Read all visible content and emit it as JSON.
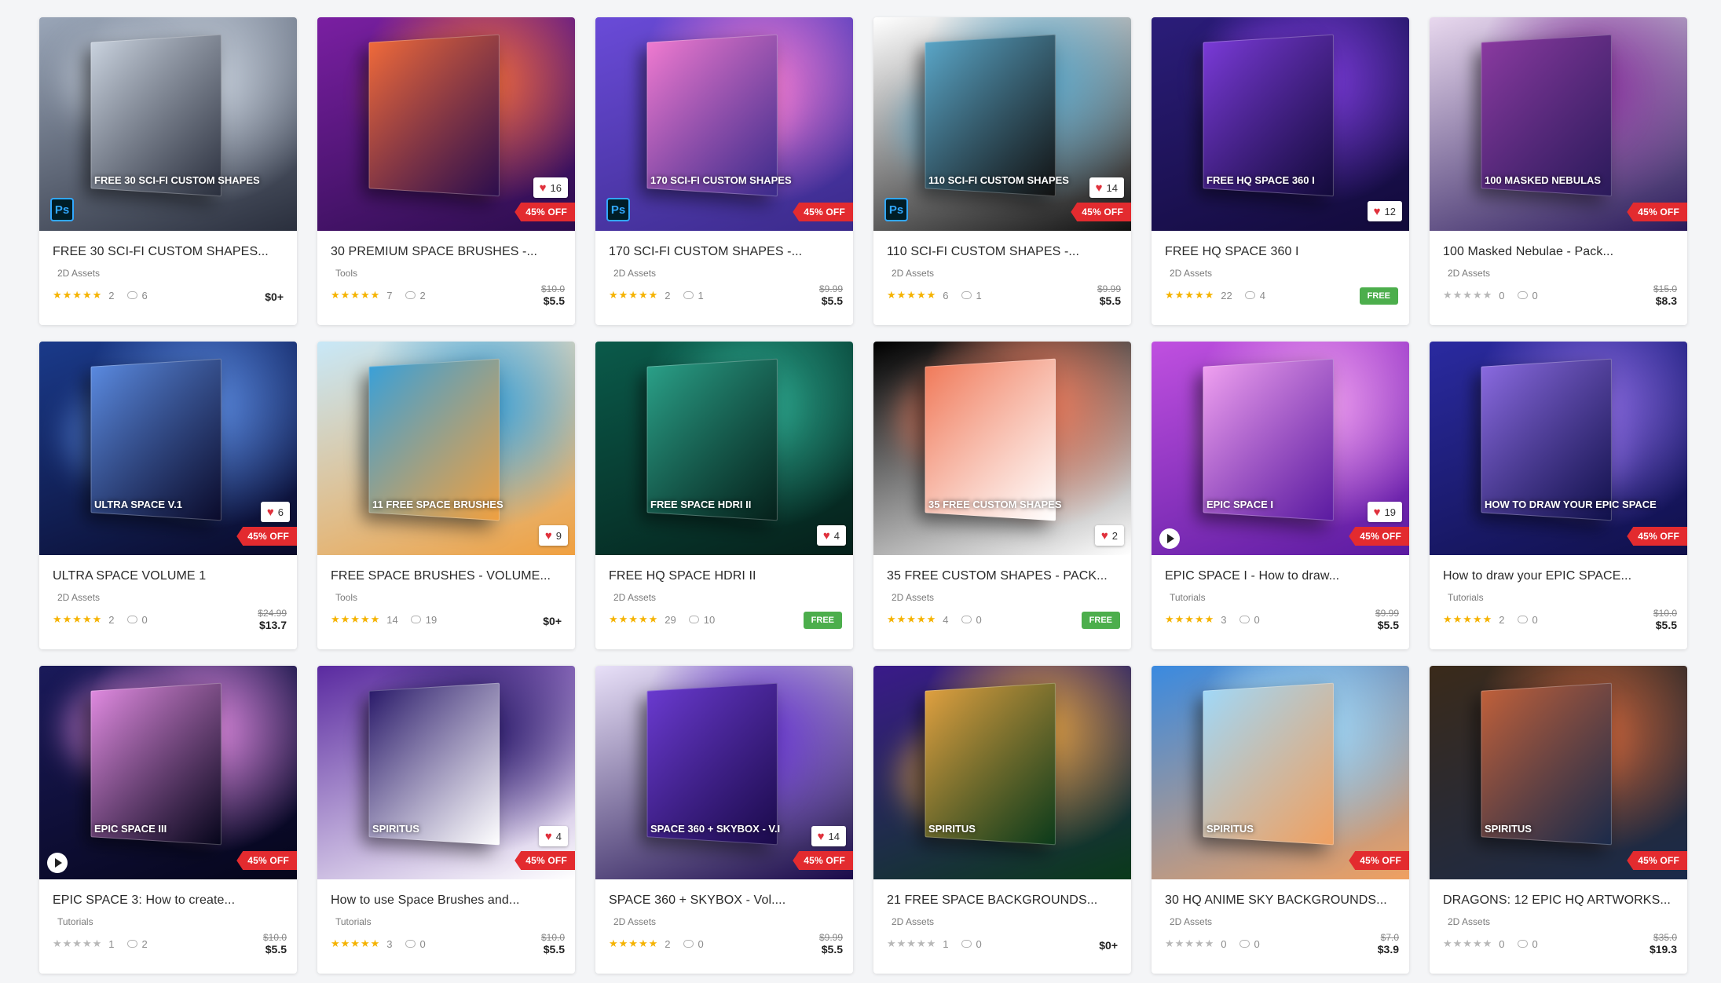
{
  "cards": [
    {
      "title": "FREE 30 SCI-FI CUSTOM SHAPES...",
      "category": "2D Assets",
      "rating": 5,
      "rating_count": "2",
      "comments": "6",
      "price_old": "",
      "price": "$0+",
      "price_type": "plus",
      "likes": "",
      "off": "",
      "ps": true,
      "play": false,
      "art_text": "FREE 30 SCI-FI CUSTOM SHAPES",
      "bg": [
        "#9aa6b8",
        "#c9d2de",
        "#2a2f3d"
      ]
    },
    {
      "title": "30 PREMIUM SPACE BRUSHES -...",
      "category": "Tools",
      "rating": 5,
      "rating_count": "7",
      "comments": "2",
      "price_old": "$10.0",
      "price": "$5.5",
      "price_type": "sale",
      "likes": "16",
      "off": "45% OFF",
      "ps": false,
      "play": false,
      "art_text": "",
      "bg": [
        "#7a1fa2",
        "#f06a3a",
        "#2b0d4d"
      ]
    },
    {
      "title": "170 SCI-FI CUSTOM SHAPES -...",
      "category": "2D Assets",
      "rating": 5,
      "rating_count": "2",
      "comments": "1",
      "price_old": "$9.99",
      "price": "$5.5",
      "price_type": "sale",
      "likes": "",
      "off": "45% OFF",
      "ps": true,
      "play": false,
      "art_text": "170 SCI-FI CUSTOM SHAPES",
      "bg": [
        "#6a4bd8",
        "#f07ad0",
        "#3a2a8a"
      ]
    },
    {
      "title": "110 SCI-FI CUSTOM SHAPES -...",
      "category": "2D Assets",
      "rating": 5,
      "rating_count": "6",
      "comments": "1",
      "price_old": "$9.99",
      "price": "$5.5",
      "price_type": "sale",
      "likes": "14",
      "off": "45% OFF",
      "ps": true,
      "play": false,
      "art_text": "110 SCI-FI CUSTOM SHAPES",
      "bg": [
        "#ffffff",
        "#5aa6c8",
        "#111111"
      ]
    },
    {
      "title": "FREE HQ SPACE 360 I",
      "category": "2D Assets",
      "rating": 5,
      "rating_count": "22",
      "comments": "4",
      "price_old": "",
      "price": "FREE",
      "price_type": "free",
      "likes": "12",
      "off": "",
      "ps": false,
      "play": false,
      "art_text": "FREE HQ SPACE 360 I",
      "bg": [
        "#2b1d7a",
        "#7a3ad8",
        "#120a3a"
      ]
    },
    {
      "title": "100 Masked Nebulae - Pack...",
      "category": "2D Assets",
      "rating": 0,
      "rating_count": "0",
      "comments": "0",
      "price_old": "$15.0",
      "price": "$8.3",
      "price_type": "sale",
      "likes": "",
      "off": "45% OFF",
      "ps": false,
      "play": false,
      "art_text": "100 MASKED NEBULAS",
      "bg": [
        "#e8d8ee",
        "#8a3aa0",
        "#2a1a5a"
      ]
    },
    {
      "title": "ULTRA SPACE VOLUME 1",
      "category": "2D Assets",
      "rating": 5,
      "rating_count": "2",
      "comments": "0",
      "price_old": "$24.99",
      "price": "$13.7",
      "price_type": "sale",
      "likes": "6",
      "off": "45% OFF",
      "ps": false,
      "play": false,
      "art_text": "ULTRA SPACE V.1",
      "bg": [
        "#1a3a8a",
        "#5a8ae0",
        "#0a0a2a"
      ]
    },
    {
      "title": "FREE SPACE BRUSHES - VOLUME...",
      "category": "Tools",
      "rating": 5,
      "rating_count": "14",
      "comments": "19",
      "price_old": "",
      "price": "$0+",
      "price_type": "plus",
      "likes": "9",
      "off": "",
      "ps": false,
      "play": false,
      "art_text": "11 FREE SPACE BRUSHES",
      "bg": [
        "#c8e8f8",
        "#3aa0d8",
        "#f0a040"
      ]
    },
    {
      "title": "FREE HQ SPACE HDRI II",
      "category": "2D Assets",
      "rating": 5,
      "rating_count": "29",
      "comments": "10",
      "price_old": "",
      "price": "FREE",
      "price_type": "free",
      "likes": "4",
      "off": "",
      "ps": false,
      "play": false,
      "art_text": "FREE SPACE HDRI II",
      "bg": [
        "#0a5a4a",
        "#2aa088",
        "#05201a"
      ]
    },
    {
      "title": "35 FREE CUSTOM SHAPES - PACK...",
      "category": "2D Assets",
      "rating": 5,
      "rating_count": "4",
      "comments": "0",
      "price_old": "",
      "price": "FREE",
      "price_type": "free",
      "likes": "2",
      "off": "",
      "ps": false,
      "play": false,
      "art_text": "35 FREE CUSTOM SHAPES",
      "bg": [
        "#000000",
        "#f07a5a",
        "#ffffff"
      ]
    },
    {
      "title": "EPIC SPACE I - How to draw...",
      "category": "Tutorials",
      "rating": 5,
      "rating_count": "3",
      "comments": "0",
      "price_old": "$9.99",
      "price": "$5.5",
      "price_type": "sale",
      "likes": "19",
      "off": "45% OFF",
      "ps": false,
      "play": true,
      "art_text": "EPIC SPACE I",
      "bg": [
        "#c050e0",
        "#f0a0f0",
        "#5a1aa0"
      ]
    },
    {
      "title": "How to draw your EPIC SPACE...",
      "category": "Tutorials",
      "rating": 5,
      "rating_count": "2",
      "comments": "0",
      "price_old": "$10.0",
      "price": "$5.5",
      "price_type": "sale",
      "likes": "",
      "off": "45% OFF",
      "ps": false,
      "play": false,
      "art_text": "HOW TO DRAW YOUR EPIC SPACE",
      "bg": [
        "#2a2aa0",
        "#8a6ae0",
        "#10104a"
      ]
    },
    {
      "title": "EPIC SPACE 3: How to create...",
      "category": "Tutorials",
      "rating": 0,
      "rating_count": "1",
      "comments": "2",
      "price_old": "$10.0",
      "price": "$5.5",
      "price_type": "sale",
      "likes": "",
      "off": "45% OFF",
      "ps": false,
      "play": true,
      "art_text": "EPIC SPACE III",
      "bg": [
        "#1a1a5a",
        "#e08ae0",
        "#05051a"
      ]
    },
    {
      "title": "How to use Space Brushes and...",
      "category": "Tutorials",
      "rating": 5,
      "rating_count": "3",
      "comments": "0",
      "price_old": "$10.0",
      "price": "$5.5",
      "price_type": "sale",
      "likes": "4",
      "off": "45% OFF",
      "ps": false,
      "play": false,
      "art_text": "SPIRITUS",
      "bg": [
        "#5a2aa0",
        "#2a1a6a",
        "#ffffff"
      ]
    },
    {
      "title": "SPACE 360 + SKYBOX - Vol....",
      "category": "2D Assets",
      "rating": 5,
      "rating_count": "2",
      "comments": "0",
      "price_old": "$9.99",
      "price": "$5.5",
      "price_type": "sale",
      "likes": "14",
      "off": "45% OFF",
      "ps": false,
      "play": false,
      "art_text": "SPACE 360 + SKYBOX - V.I",
      "bg": [
        "#e8e0f8",
        "#6a3ad0",
        "#1a0a4a"
      ]
    },
    {
      "title": "21 FREE SPACE BACKGROUNDS...",
      "category": "2D Assets",
      "rating": 0,
      "rating_count": "1",
      "comments": "0",
      "price_old": "",
      "price": "$0+",
      "price_type": "plus",
      "likes": "",
      "off": "",
      "ps": false,
      "play": false,
      "art_text": "SPIRITUS",
      "bg": [
        "#3a1a8a",
        "#e0a040",
        "#0a3a1a"
      ]
    },
    {
      "title": "30 HQ ANIME SKY BACKGROUNDS...",
      "category": "2D Assets",
      "rating": 0,
      "rating_count": "0",
      "comments": "0",
      "price_old": "$7.0",
      "price": "$3.9",
      "price_type": "sale",
      "likes": "",
      "off": "45% OFF",
      "ps": false,
      "play": false,
      "art_text": "SPIRITUS",
      "bg": [
        "#3a8ae0",
        "#a0d8f8",
        "#f0a060"
      ]
    },
    {
      "title": "DRAGONS: 12 EPIC HQ ARTWORKS...",
      "category": "2D Assets",
      "rating": 0,
      "rating_count": "0",
      "comments": "0",
      "price_old": "$35.0",
      "price": "$19.3",
      "price_type": "sale",
      "likes": "",
      "off": "45% OFF",
      "ps": false,
      "play": false,
      "art_text": "SPIRITUS",
      "bg": [
        "#3a2a1a",
        "#c0603a",
        "#1a2a4a"
      ]
    }
  ]
}
